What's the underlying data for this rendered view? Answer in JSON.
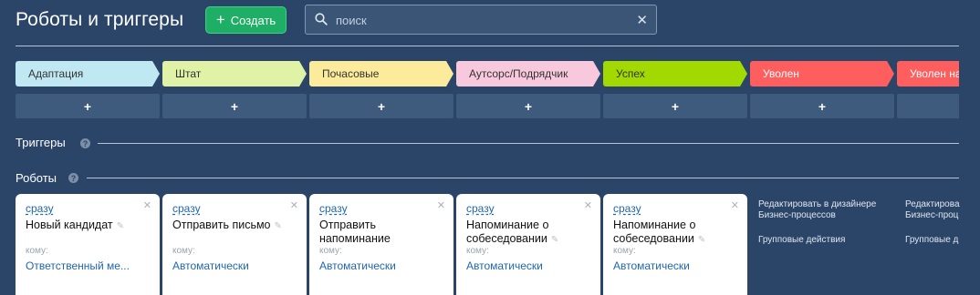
{
  "header": {
    "title": "Роботы и триггеры",
    "create_label": "Создать",
    "search_placeholder": "поиск"
  },
  "stages": [
    {
      "label": "Адаптация",
      "color": "#c0e8f3"
    },
    {
      "label": "Штат",
      "color": "#dff2a6"
    },
    {
      "label": "Почасовые",
      "color": "#fdeb9c"
    },
    {
      "label": "Аутсорс/Подрядчик",
      "color": "#f8c9dd"
    },
    {
      "label": "Успех",
      "color": "#a2d900"
    },
    {
      "label": "Уволен",
      "color": "#ff5e5e"
    },
    {
      "label": "Уволен на",
      "color": "#ff5e5e"
    }
  ],
  "add_label": "+",
  "sections": {
    "triggers": "Триггеры",
    "robots": "Роботы"
  },
  "robots": [
    {
      "when": "сразу",
      "name": "Новый кандидат",
      "whom_label": "кому:",
      "responsible": "Ответственный ме..."
    },
    {
      "when": "сразу",
      "name": "Отправить письмо",
      "whom_label": "кому:",
      "responsible": "Автоматически"
    },
    {
      "when": "сразу",
      "name": "Отправить напоминание",
      "whom_label": "кому:",
      "responsible": "Автоматически"
    },
    {
      "when": "сразу",
      "name": "Напоминание о собеседовании",
      "whom_label": "кому:",
      "responsible": "Автоматически"
    },
    {
      "when": "сразу",
      "name": "Напоминание о собеседовании",
      "whom_label": "кому:",
      "responsible": "Автоматически"
    }
  ],
  "side_actions": [
    {
      "edit": "Редактировать в дизайнере Бизнес-процессов",
      "group": "Групповые действия"
    },
    {
      "edit": "Редактирова Бизнес-проц",
      "group": "Групповые д"
    }
  ]
}
